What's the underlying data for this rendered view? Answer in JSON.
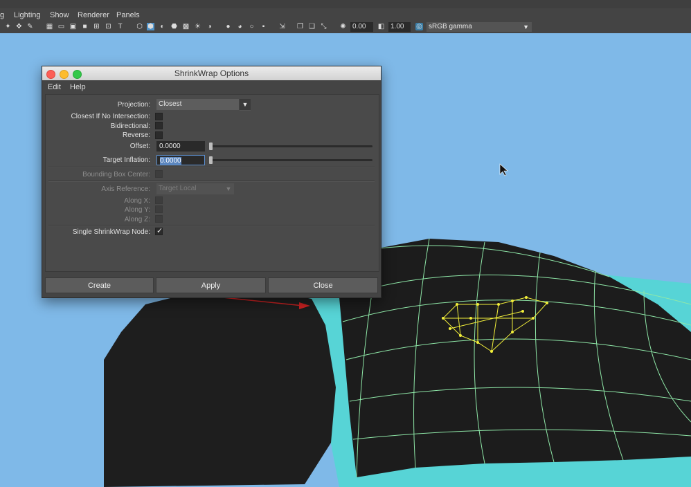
{
  "menubar": {
    "items": [
      "g",
      "Lighting",
      "Show",
      "Renderer",
      "Panels"
    ]
  },
  "toolbar": {
    "value_a": "0.00",
    "value_b": "1.00",
    "color_space": "sRGB gamma"
  },
  "dialog": {
    "title": "ShrinkWrap Options",
    "menu": [
      "Edit",
      "Help"
    ],
    "fields": {
      "projection_label": "Projection:",
      "projection_value": "Closest",
      "closest_if_no_intersection_label": "Closest If No Intersection:",
      "bidirectional_label": "Bidirectional:",
      "reverse_label": "Reverse:",
      "offset_label": "Offset:",
      "offset_value": "0.0000",
      "offset_slider": 0,
      "target_inflation_label": "Target Inflation:",
      "target_inflation_value": "0.0000",
      "target_inflation_slider": 0,
      "bounding_box_center_label": "Bounding Box Center:",
      "axis_reference_label": "Axis Reference:",
      "axis_reference_value": "Target Local",
      "along_x_label": "Along X:",
      "along_y_label": "Along Y:",
      "along_z_label": "Along Z:",
      "single_node_label": "Single ShrinkWrap Node:",
      "single_node_checked": true
    },
    "buttons": {
      "create": "Create",
      "apply": "Apply",
      "close": "Close"
    }
  },
  "colors": {
    "viewport_bg": "#7fb9e8",
    "wire": "#8fe8a8",
    "selection": "#f2ef3a",
    "mesh": "#1c1c1c",
    "cyan_mesh": "#57d4d6"
  }
}
